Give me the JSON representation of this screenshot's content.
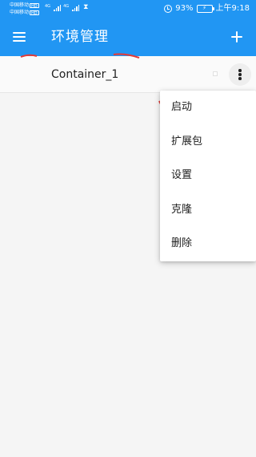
{
  "status_bar": {
    "carrier_1": "中国移动",
    "carrier_2": "中国移动",
    "hd_badge": "HD",
    "network_tag_1": "4G",
    "network_tag_2": "4G",
    "battery_percent": "93%",
    "time": "上午9:18",
    "icons": [
      "signal-icon",
      "hourglass-icon",
      "alarm-icon",
      "battery-charging-icon"
    ]
  },
  "app_bar": {
    "title": "环境管理",
    "background_color": "#2196f3",
    "icons": [
      "menu-icon",
      "add-icon"
    ]
  },
  "environments": [
    {
      "name": "Container_1"
    }
  ],
  "overflow_menu": {
    "items": [
      {
        "label": "启动"
      },
      {
        "label": "扩展包"
      },
      {
        "label": "设置"
      },
      {
        "label": "克隆"
      },
      {
        "label": "删除"
      }
    ]
  }
}
